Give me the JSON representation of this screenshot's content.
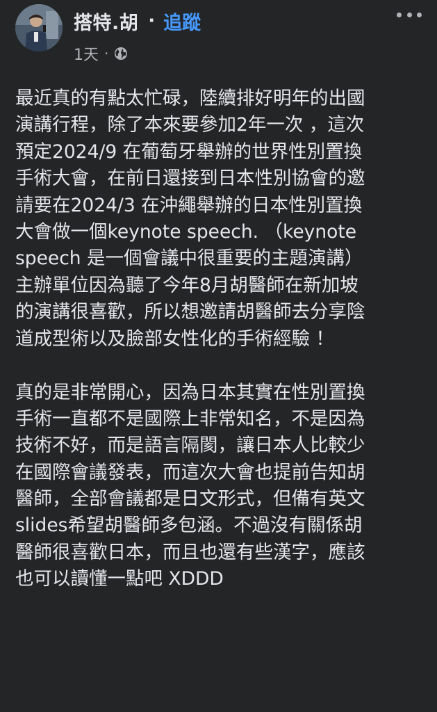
{
  "author": {
    "name": "搭特.胡",
    "separator": "·",
    "follow_label": "追蹤",
    "avatar_icon": "profile-photo"
  },
  "meta": {
    "time": "1天",
    "separator": "·",
    "audience_icon": "globe-icon"
  },
  "menu": {
    "icon": "more-options-icon"
  },
  "post": {
    "paragraphs": [
      [
        "最近真的有點太忙碌，陸續排好明年的出國",
        "演講行程，除了本來要參加2年一次 ，這次",
        "預定2024/9 在葡萄牙舉辦的世界性別置換",
        "手術大會，在前日還接到日本性別協會的邀",
        "請要在2024/3 在沖繩舉辦的日本性別置換",
        "大會做一個keynote speech. （keynote",
        "speech 是一個會議中很重要的主題演講）",
        "主辦單位因為聽了今年8月胡醫師在新加坡",
        "的演講很喜歡，所以想邀請胡醫師去分享陰",
        "道成型術以及臉部女性化的手術經驗 ！"
      ],
      [
        "真的是非常開心，因為日本其實在性別置換",
        "手術一直都不是國際上非常知名，不是因為",
        "技術不好，而是語言隔閡，讓日本人比較少",
        "在國際會議發表，而這次大會也提前告知胡",
        "醫師，全部會議都是日文形式，但備有英文",
        "slides希望胡醫師多包涵。不過沒有關係胡",
        "醫師很喜歡日本，而且也還有些漢字，應該",
        "也可以讀懂一點吧 XDDD"
      ]
    ]
  },
  "colors": {
    "background": "#242526",
    "text_primary": "#e4e6eb",
    "text_secondary": "#b0b3b8",
    "link": "#4599ff"
  }
}
